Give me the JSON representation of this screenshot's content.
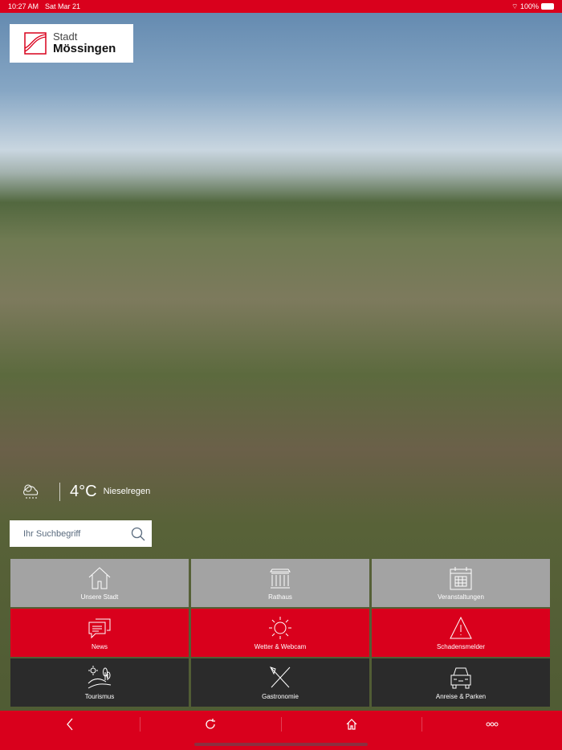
{
  "status": {
    "time": "10:27 AM",
    "date": "Sat Mar 21",
    "battery": "100%"
  },
  "logo": {
    "line1": "Stadt",
    "line2": "Mössingen"
  },
  "weather": {
    "icon": "cloud-drizzle-icon",
    "temperature": "4°C",
    "description": "Nieselregen"
  },
  "search": {
    "placeholder": "Ihr Suchbegriff"
  },
  "tiles": [
    {
      "label": "Unsere Stadt",
      "icon": "house-icon"
    },
    {
      "label": "Rathaus",
      "icon": "town-hall-icon"
    },
    {
      "label": "Veranstaltungen",
      "icon": "calendar-icon"
    },
    {
      "label": "News",
      "icon": "chat-bubbles-icon"
    },
    {
      "label": "Wetter & Webcam",
      "icon": "sun-icon"
    },
    {
      "label": "Schadensmelder",
      "icon": "warning-icon"
    },
    {
      "label": "Tourismus",
      "icon": "landscape-icon"
    },
    {
      "label": "Gastronomie",
      "icon": "fork-knife-icon"
    },
    {
      "label": "Anreise & Parken",
      "icon": "car-icon"
    }
  ],
  "colors": {
    "brand": "#d9001c",
    "grey": "#a3a3a3",
    "dark": "#2b2b2b"
  }
}
